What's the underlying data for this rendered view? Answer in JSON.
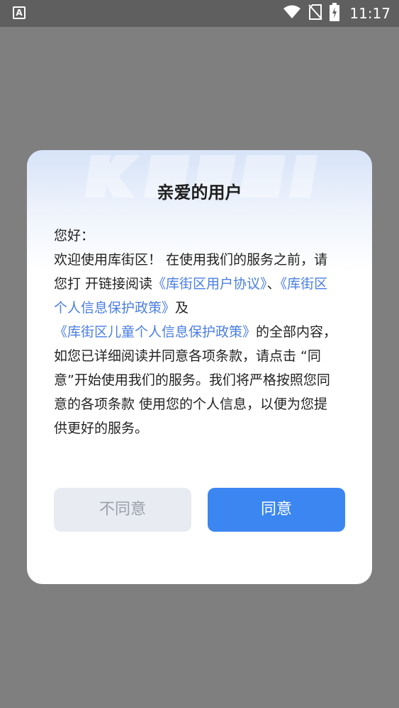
{
  "status_bar": {
    "time": "11:17",
    "app_icon_letter": "A",
    "icons": [
      "app-notification-icon",
      "wifi-icon",
      "no-sim-icon",
      "battery-charging-icon"
    ]
  },
  "dialog": {
    "title": "亲爱的用户",
    "greeting": "您好：",
    "body_part1": "欢迎使用库街区！ 在使用我们的服务之前，请您打 开链接阅读",
    "link1": "《库街区用户协议》",
    "separator": "、",
    "link2": "《库街区个人信息保护政策》",
    "conjunction": "及",
    "link3": "《库街区儿童个人信息保护政策》",
    "body_part2": "的全部内容，如您已详细阅读并同意各项条款，请点击 “同意”开始使用我们的服务。我们将严格按照您同意的各项条款 使用您的个人信息，以便为您提 供更好的服务。",
    "disagree_label": "不同意",
    "agree_label": "同意",
    "link_color": "#4a7ee3",
    "agree_color": "#3b86f0"
  }
}
